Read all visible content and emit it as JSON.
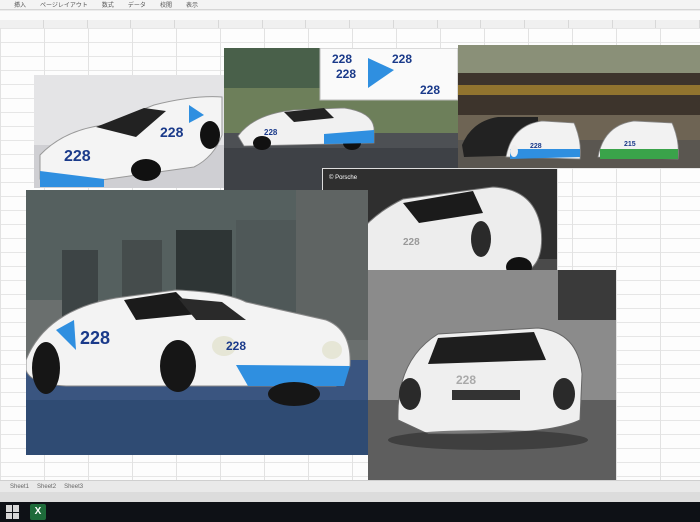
{
  "ribbon": {
    "menus": [
      "挿入",
      "ページレイアウト",
      "数式",
      "データ",
      "校閲",
      "表示"
    ]
  },
  "photos": {
    "a": {
      "car_number": "228"
    },
    "b": {
      "car_number": "228",
      "decal_numbers": [
        "228",
        "228",
        "228",
        "228"
      ]
    },
    "c": {
      "car_numbers": [
        "228",
        "215"
      ]
    },
    "d": {
      "credit": "© Porsche",
      "car_number": "228"
    },
    "e": {
      "car_number": "228"
    },
    "f": {
      "car_number": "228"
    }
  },
  "sheet_tabs": [
    "Sheet1",
    "Sheet2",
    "Sheet3"
  ],
  "taskbar": {
    "app": "X"
  },
  "colors": {
    "livery_blue": "#2f8fe0",
    "car_white": "#f4f4f4",
    "livery_green": "#3aa34a",
    "taskbar": "#0e1116"
  }
}
